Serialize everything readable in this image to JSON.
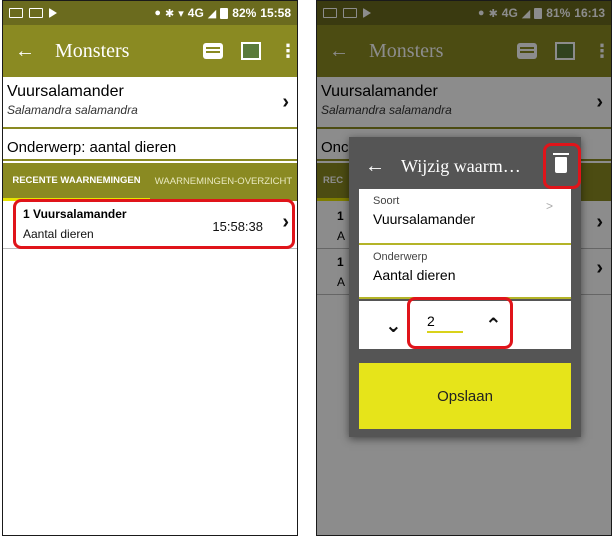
{
  "left": {
    "statusbar": {
      "network": "4G",
      "battery": "82%",
      "time": "15:58"
    },
    "appbar": {
      "back": "←",
      "title": "Monsters",
      "more": "⋮"
    },
    "species": {
      "name": "Vuursalamander",
      "latin": "Salamandra salamandra",
      "chevron": "›"
    },
    "subject": "Onderwerp: aantal dieren",
    "tabs": [
      {
        "label": "RECENTE WAARNEMINGEN"
      },
      {
        "label": "WAARNEMINGEN-OVERZICHT"
      }
    ],
    "observation": {
      "title": "1 Vuursalamander",
      "subtitle": "Aantal dieren",
      "time": "15:58:38",
      "chevron": "›"
    }
  },
  "right": {
    "statusbar": {
      "network": "4G",
      "battery": "81%",
      "time": "16:13"
    },
    "appbar": {
      "back": "←",
      "title": "Monsters",
      "more": "⋮"
    },
    "species": {
      "name": "Vuursalamander",
      "latin": "Salamandra salamandra",
      "chevron": "›"
    },
    "subject_partial": "Onc",
    "tab_partial": "REC",
    "dialog": {
      "back": "←",
      "title": "Wijzig waarm…",
      "soort_label": "Soort",
      "soort_value": "Vuursalamander",
      "onderwerp_label": "Onderwerp",
      "onderwerp_value": "Aantal dieren",
      "decrement": "⌄",
      "increment": "⌃",
      "count": "2",
      "save_label": "Opslaan"
    },
    "list_chevrons": [
      "›",
      "›"
    ],
    "list_left_chars": [
      "1",
      "A",
      "1",
      "A"
    ]
  },
  "colors": {
    "statusbar": "#6b6b1e",
    "appbar": "#8a8a22",
    "accent": "#e6e41a",
    "highlight": "#e0141a"
  }
}
